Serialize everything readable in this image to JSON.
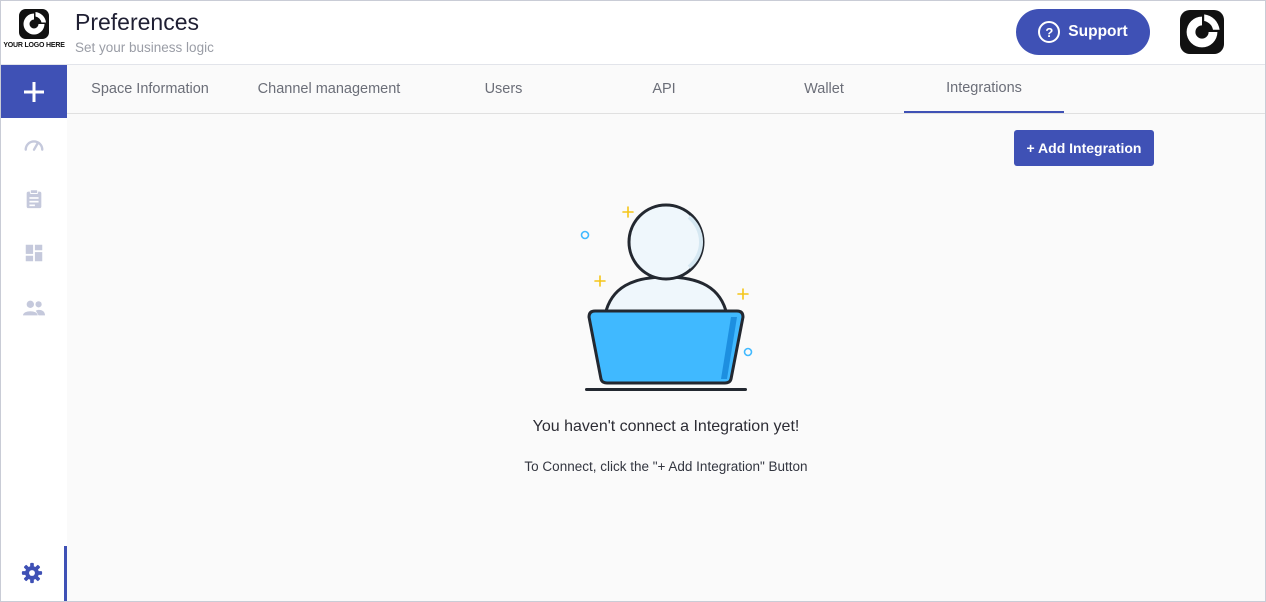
{
  "header": {
    "logo_text": "YOUR LOGO HERE",
    "title": "Preferences",
    "subtitle": "Set your business logic",
    "support_label": "Support"
  },
  "sidebar": {
    "items": [
      {
        "icon": "dashboard-gauge-icon"
      },
      {
        "icon": "clipboard-icon"
      },
      {
        "icon": "layout-icon"
      },
      {
        "icon": "people-icon"
      }
    ],
    "bottom_icon": "gear-icon"
  },
  "tabs": [
    {
      "label": "Space Information",
      "active": false
    },
    {
      "label": "Channel management",
      "active": false
    },
    {
      "label": "Users",
      "active": false
    },
    {
      "label": "API",
      "active": false
    },
    {
      "label": "Wallet",
      "active": false
    },
    {
      "label": "Integrations",
      "active": true
    }
  ],
  "content": {
    "add_button_label": "+ Add Integration",
    "empty_title": "You haven't connect a Integration yet!",
    "empty_hint": "To Connect, click the \"+ Add Integration\" Button"
  },
  "colors": {
    "accent": "#3f51b5",
    "laptop": "#40b9ff",
    "sparkle": "#f5c518"
  }
}
